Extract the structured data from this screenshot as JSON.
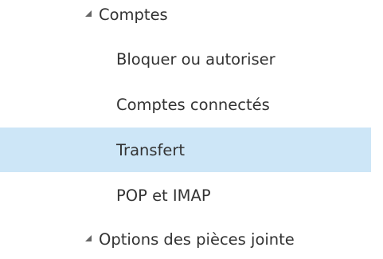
{
  "nav": {
    "items": [
      {
        "label": "Comptes",
        "type": "group",
        "expanded": true
      },
      {
        "label": "Bloquer ou autoriser",
        "type": "child"
      },
      {
        "label": "Comptes connectés",
        "type": "child"
      },
      {
        "label": "Transfert",
        "type": "child",
        "selected": true
      },
      {
        "label": "POP et IMAP",
        "type": "child"
      },
      {
        "label": "Options des pièces jointe",
        "type": "group",
        "expanded": true
      }
    ]
  },
  "icons": {
    "expanded": "caret-down-right-icon"
  },
  "colors": {
    "text": "#333333",
    "selected_background": "#cde6f7",
    "caret": "#666666"
  }
}
